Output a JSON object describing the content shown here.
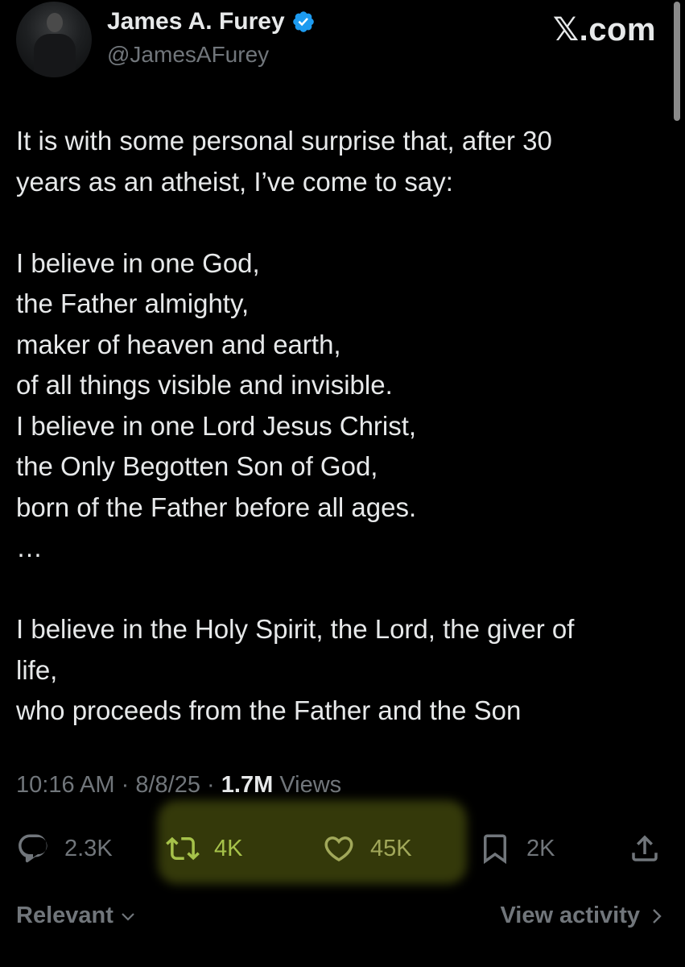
{
  "author": {
    "display_name": "James A. Furey",
    "handle": "@JamesAFurey",
    "verified_icon": "verified-badge-icon",
    "verified_color": "#1d9bf0"
  },
  "brand": "𝕏.com",
  "tweet": {
    "lines": [
      "It is with some personal surprise that, after 30",
      "years as an atheist, I’ve come to say:",
      "",
      "I believe in one God,",
      "the Father almighty,",
      "maker of heaven and earth,",
      "of all things visible and invisible.",
      "I believe in one Lord Jesus Christ,",
      "the Only Begotten Son of God,",
      "born of the Father before all ages.",
      "…",
      "",
      "I believe in the Holy Spirit, the Lord, the giver of",
      "life,",
      "who proceeds from the Father and the Son"
    ]
  },
  "meta": {
    "time": "10:16 AM",
    "date": "8/8/25",
    "separator": "·",
    "views_count": "1.7M",
    "views_label": "Views"
  },
  "actions": {
    "reply": {
      "count": "2.3K",
      "icon": "reply-icon"
    },
    "repost": {
      "count": "4K",
      "icon": "repost-icon"
    },
    "like": {
      "count": "45K",
      "icon": "heart-icon"
    },
    "bookmark": {
      "count": "2K",
      "icon": "bookmark-icon"
    },
    "share": {
      "icon": "share-icon"
    }
  },
  "footer": {
    "sort_label": "Relevant",
    "view_activity_label": "View activity"
  },
  "colors": {
    "background": "#000000",
    "text": "#e7e9ea",
    "secondary": "#71767b",
    "highlight": "#c8dc28"
  }
}
